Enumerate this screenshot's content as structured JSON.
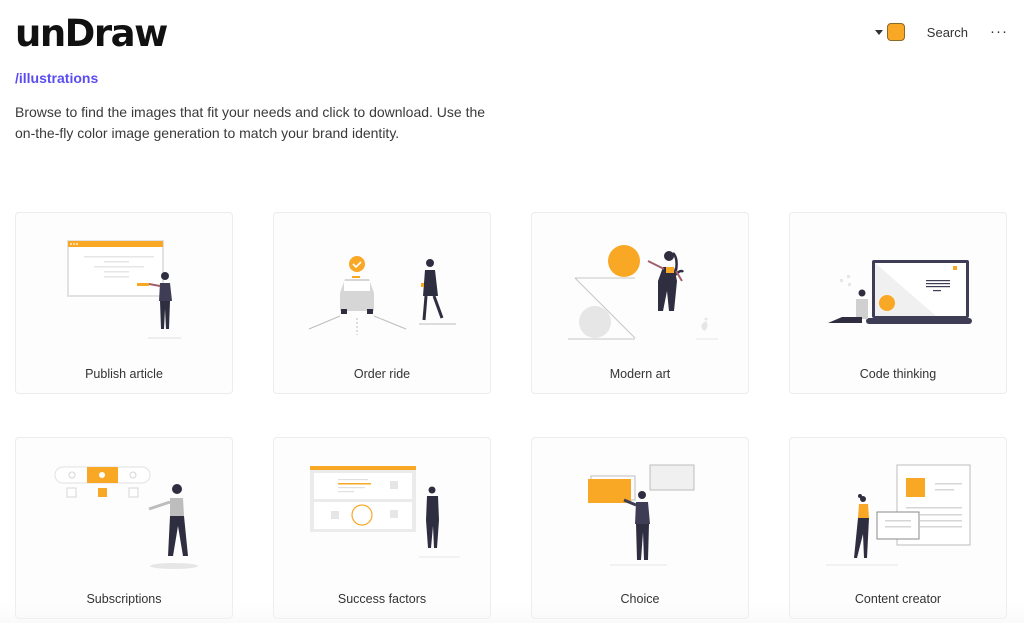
{
  "header": {
    "logo": "unDraw",
    "breadcrumb": "/illustrations",
    "description": "Browse to find the images that fit your needs and click to download. Use the on-the-fly color image generation to match your brand identity."
  },
  "topbar": {
    "color_picker_icon": "caret-down-icon",
    "selected_color": "#f9a826",
    "search_label": "Search",
    "more_label": "···"
  },
  "theme": {
    "accent": "#f9a826",
    "link": "#5a4cf0",
    "figure_dark": "#2f2e41"
  },
  "illustrations": [
    {
      "title": "Publish article"
    },
    {
      "title": "Order ride"
    },
    {
      "title": "Modern art"
    },
    {
      "title": "Code thinking"
    },
    {
      "title": "Subscriptions"
    },
    {
      "title": "Success factors"
    },
    {
      "title": "Choice"
    },
    {
      "title": "Content creator"
    }
  ]
}
